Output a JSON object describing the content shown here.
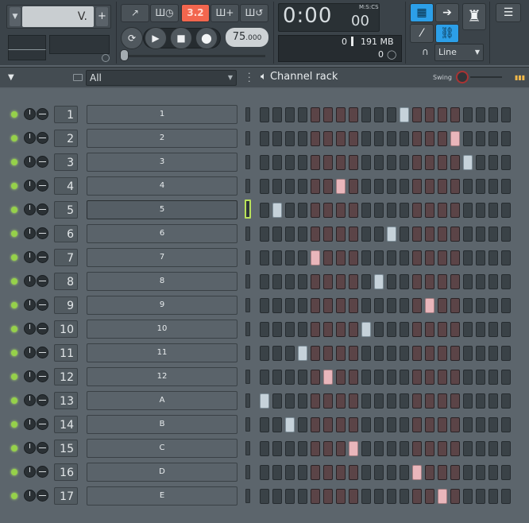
{
  "toolbar": {
    "pattern_value": "V.",
    "pattern_plus": "+",
    "mode_buttons": [
      "↗",
      "Ш◷",
      "3.2",
      "Ш+",
      "Ш↺"
    ],
    "tempo_main": "75",
    "tempo_decimal": ".000",
    "time_main": "0:00",
    "time_sub": "00",
    "time_label": "M:S:CS",
    "cpu_value": "0",
    "memory": "191 MB",
    "polyphony": "0",
    "snap_mode": "Line",
    "colors": {
      "accent_active": "#f2664e",
      "highlight_blue": "#2c9fe8"
    }
  },
  "rack": {
    "filter": "All",
    "title": "Channel rack",
    "swing_label": "Swing"
  },
  "channels": [
    {
      "number": "1",
      "name": "1",
      "active_step": 11,
      "selected": false
    },
    {
      "number": "2",
      "name": "2",
      "active_step": 15,
      "selected": false
    },
    {
      "number": "3",
      "name": "3",
      "active_step": 16,
      "selected": false
    },
    {
      "number": "4",
      "name": "4",
      "active_step": 6,
      "selected": false
    },
    {
      "number": "5",
      "name": "5",
      "active_step": 1,
      "selected": true
    },
    {
      "number": "6",
      "name": "6",
      "active_step": 10,
      "selected": false
    },
    {
      "number": "7",
      "name": "7",
      "active_step": 4,
      "selected": false
    },
    {
      "number": "8",
      "name": "8",
      "active_step": 9,
      "selected": false
    },
    {
      "number": "9",
      "name": "9",
      "active_step": 13,
      "selected": false
    },
    {
      "number": "10",
      "name": "10",
      "active_step": 8,
      "selected": false
    },
    {
      "number": "11",
      "name": "11",
      "active_step": 3,
      "selected": false
    },
    {
      "number": "12",
      "name": "12",
      "active_step": 5,
      "selected": false
    },
    {
      "number": "13",
      "name": "A",
      "active_step": 0,
      "selected": false
    },
    {
      "number": "14",
      "name": "B",
      "active_step": 2,
      "selected": false
    },
    {
      "number": "15",
      "name": "C",
      "active_step": 7,
      "selected": false
    },
    {
      "number": "16",
      "name": "D",
      "active_step": 12,
      "selected": false
    },
    {
      "number": "17",
      "name": "E",
      "active_step": 14,
      "selected": false
    }
  ],
  "steps_per_row": 20
}
